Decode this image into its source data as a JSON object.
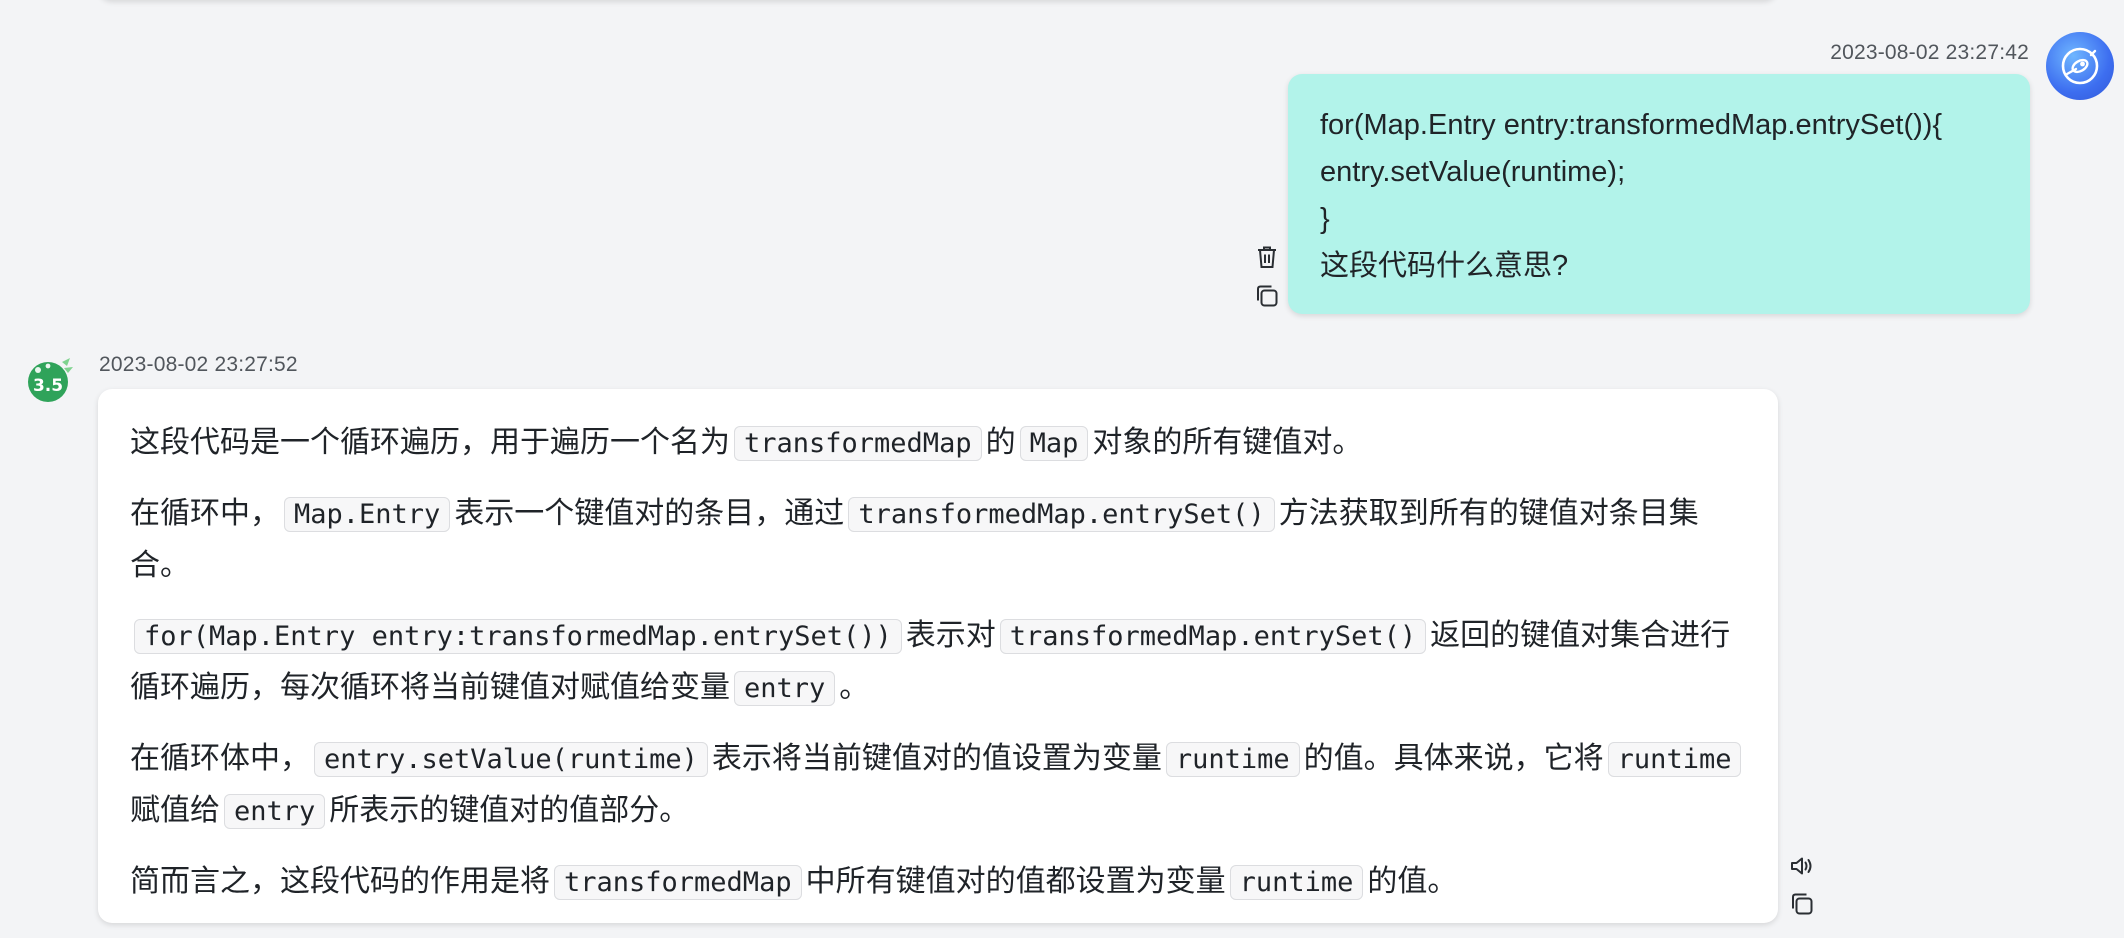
{
  "conversation": {
    "user_message": {
      "timestamp": "2023-08-02 23:27:42",
      "lines": [
        "for(Map.Entry entry:transformedMap.entrySet()){",
        "entry.setValue(runtime);",
        "}",
        "这段代码什么意思?"
      ],
      "actions": {
        "delete_icon": "trash-icon",
        "copy_icon": "copy-icon"
      }
    },
    "assistant_message": {
      "timestamp": "2023-08-02 23:27:52",
      "avatar_badge": "3.5",
      "p1": {
        "t1": "这段代码是一个循环遍历，用于遍历一个名为",
        "c1": "transformedMap",
        "t2": "的",
        "c2": "Map",
        "t3": "对象的所有键值对。"
      },
      "p2": {
        "t1": "在循环中，",
        "c1": "Map.Entry",
        "t2": "表示一个键值对的条目，通过",
        "c2": "transformedMap.entrySet()",
        "t3": "方法获取到所有的键值对条目集合。"
      },
      "p3": {
        "c1": "for(Map.Entry entry:transformedMap.entrySet())",
        "t1": "表示对",
        "c2": "transformedMap.entrySet()",
        "t2": "返回的键值对集合进行循环遍历，每次循环将当前键值对赋值给变量",
        "c3": "entry",
        "t3": "。"
      },
      "p4": {
        "t1": "在循环体中，",
        "c1": "entry.setValue(runtime)",
        "t2": "表示将当前键值对的值设置为变量",
        "c2": "runtime",
        "t3": "的值。具体来说，它将",
        "c3": "runtime",
        "t4": "赋值给",
        "c4": "entry",
        "t5": "所表示的键值对的值部分。"
      },
      "p5": {
        "t1": "简而言之，这段代码的作用是将",
        "c1": "transformedMap",
        "t2": "中所有键值对的值都设置为变量",
        "c2": "runtime",
        "t3": "的值。"
      },
      "actions": {
        "speak_icon": "speaker-icon",
        "copy_icon": "copy-icon"
      }
    }
  },
  "colors": {
    "page_bg": "#f3f4f6",
    "user_bubble": "#b2f3ea",
    "assistant_bubble": "#ffffff",
    "user_avatar": "#3d6ef0",
    "assistant_avatar": "#2fa35a"
  }
}
